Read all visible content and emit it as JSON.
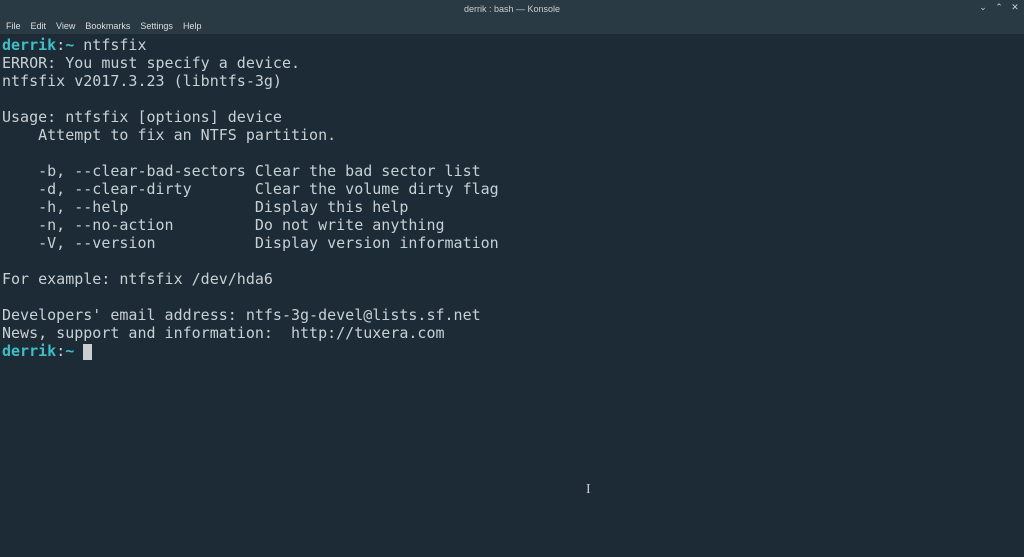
{
  "window": {
    "title": "derrik : bash — Konsole"
  },
  "menubar": {
    "items": [
      "File",
      "Edit",
      "View",
      "Bookmarks",
      "Settings",
      "Help"
    ]
  },
  "terminal": {
    "prompt_user": "derrik",
    "prompt_sep": ":",
    "prompt_path": "~",
    "command1": "ntfsfix",
    "lines": [
      "ERROR: You must specify a device.",
      "ntfsfix v2017.3.23 (libntfs-3g)",
      "",
      "Usage: ntfsfix [options] device",
      "    Attempt to fix an NTFS partition.",
      "",
      "    -b, --clear-bad-sectors Clear the bad sector list",
      "    -d, --clear-dirty       Clear the volume dirty flag",
      "    -h, --help              Display this help",
      "    -n, --no-action         Do not write anything",
      "    -V, --version           Display version information",
      "",
      "For example: ntfsfix /dev/hda6",
      "",
      "Developers' email address: ntfs-3g-devel@lists.sf.net",
      "News, support and information:  http://tuxera.com"
    ]
  },
  "window_controls": {
    "minimize": "⌄",
    "maximize": "⌃",
    "close": "✕"
  }
}
